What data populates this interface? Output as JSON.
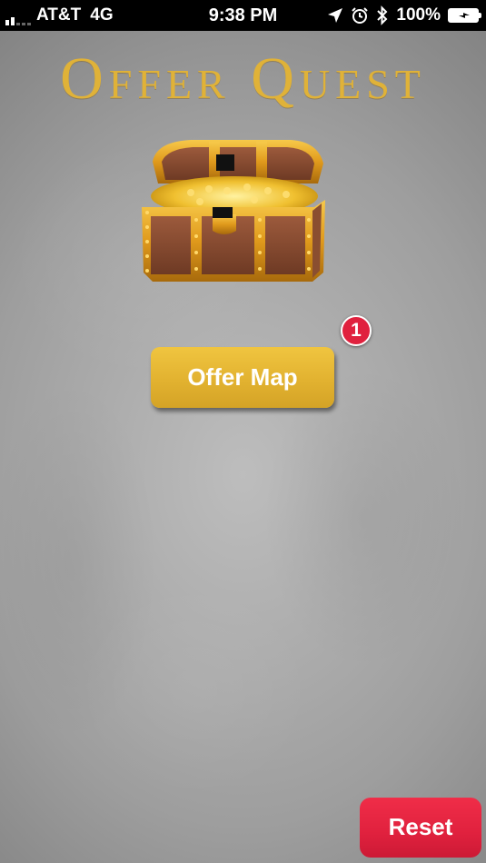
{
  "status_bar": {
    "signal_bars": 2,
    "carrier": "AT&T",
    "network": "4G",
    "time": "9:38 PM",
    "battery_percent": "100%"
  },
  "app": {
    "title": "Offer Quest"
  },
  "main": {
    "offer_map_label": "Offer Map",
    "notification_count": "1",
    "reset_label": "Reset"
  },
  "icons": {
    "location": "location-arrow-icon",
    "alarm": "alarm-clock-icon",
    "bluetooth": "bluetooth-icon",
    "battery": "battery-charging-icon",
    "chest": "treasure-chest-icon"
  },
  "colors": {
    "title_gold": "#e0b238",
    "button_gold": "#e2b230",
    "badge_red": "#e0213e",
    "reset_red": "#e0213e"
  }
}
